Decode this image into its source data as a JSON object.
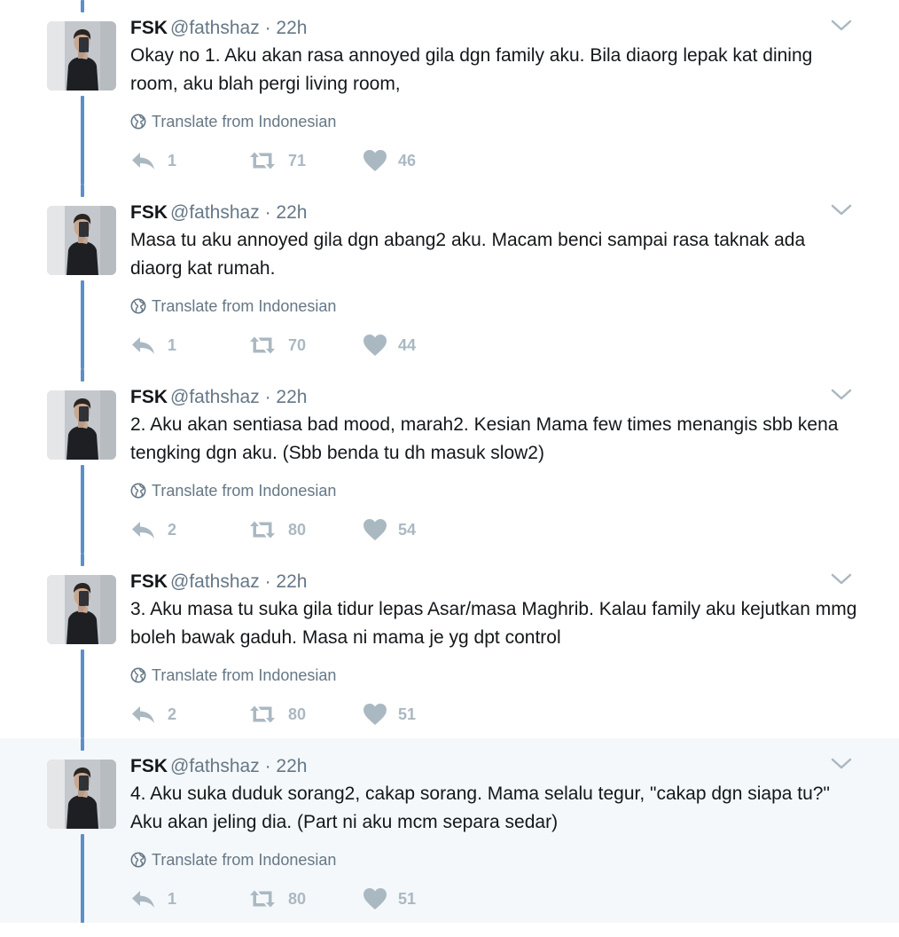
{
  "tweets": [
    {
      "name": "FSK",
      "handle": "@fathshaz",
      "time": "· 22h",
      "text": "Okay no 1. Aku akan rasa annoyed gila dgn family aku. Bila diaorg lepak kat dining room, aku blah pergi living room,",
      "translate": "Translate from Indonesian",
      "replies": "1",
      "retweets": "71",
      "likes": "46"
    },
    {
      "name": "FSK",
      "handle": "@fathshaz",
      "time": "· 22h",
      "text": "Masa tu aku annoyed gila dgn abang2 aku. Macam benci sampai rasa taknak ada diaorg kat rumah.",
      "translate": "Translate from Indonesian",
      "replies": "1",
      "retweets": "70",
      "likes": "44"
    },
    {
      "name": "FSK",
      "handle": "@fathshaz",
      "time": "· 22h",
      "text": "2. Aku akan sentiasa bad mood, marah2. Kesian Mama few times menangis sbb kena tengking dgn aku. (Sbb benda tu dh masuk slow2)",
      "translate": "Translate from Indonesian",
      "replies": "2",
      "retweets": "80",
      "likes": "54"
    },
    {
      "name": "FSK",
      "handle": "@fathshaz",
      "time": "· 22h",
      "text": "3. Aku masa tu suka gila tidur lepas Asar/masa Maghrib. Kalau family aku kejutkan mmg boleh bawak gaduh. Masa ni mama je yg dpt control",
      "translate": "Translate from Indonesian",
      "replies": "2",
      "retweets": "80",
      "likes": "51"
    },
    {
      "name": "FSK",
      "handle": "@fathshaz",
      "time": "· 22h",
      "text": "4. Aku suka duduk sorang2, cakap sorang. Mama selalu tegur, \"cakap dgn siapa tu?\" Aku akan jeling dia. (Part ni aku mcm separa sedar)",
      "translate": "Translate from Indonesian",
      "replies": "1",
      "retweets": "80",
      "likes": "51"
    }
  ],
  "icons": {
    "reply": "reply-icon",
    "retweet": "retweet-icon",
    "like": "heart-icon",
    "translate": "globe-icon",
    "menu": "chevron-down-icon"
  },
  "colors": {
    "thread_line": "#5b8fc9",
    "text": "#14171a",
    "secondary_text": "#657786",
    "action_icon": "#aab8c2",
    "highlight_background": "#f5f8fa"
  }
}
